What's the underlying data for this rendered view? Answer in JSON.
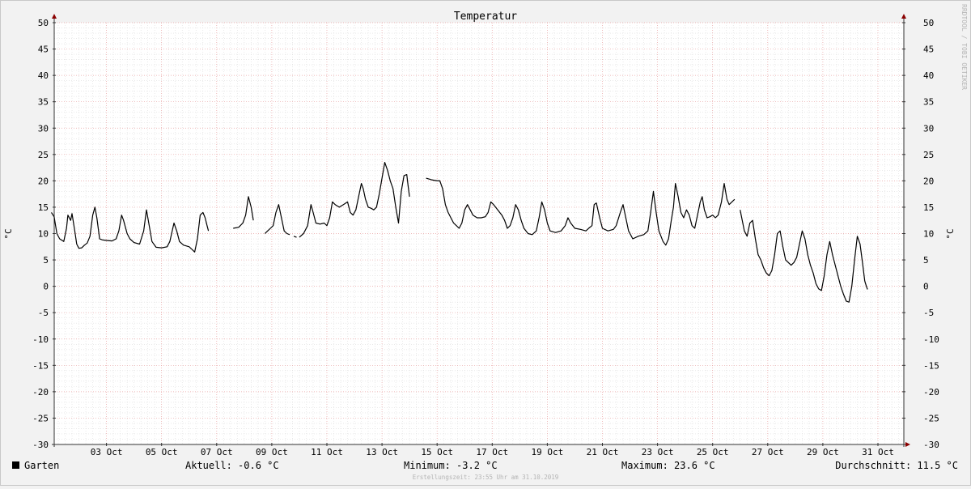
{
  "chart_data": {
    "type": "line",
    "title": "Temperatur",
    "ylabel": "°C",
    "ylim": [
      -30,
      50
    ],
    "yticks": [
      50,
      45,
      40,
      35,
      30,
      25,
      20,
      15,
      10,
      5,
      0,
      -5,
      -10,
      -15,
      -20,
      -25,
      -30
    ],
    "xlim": [
      "2019-10-01 00:00",
      "2019-11-01 00:00"
    ],
    "xtick_labels": [
      {
        "day": 3,
        "label": "03 Oct"
      },
      {
        "day": 5,
        "label": "05 Oct"
      },
      {
        "day": 7,
        "label": "07 Oct"
      },
      {
        "day": 9,
        "label": "09 Oct"
      },
      {
        "day": 11,
        "label": "11 Oct"
      },
      {
        "day": 13,
        "label": "13 Oct"
      },
      {
        "day": 15,
        "label": "15 Oct"
      },
      {
        "day": 17,
        "label": "17 Oct"
      },
      {
        "day": 19,
        "label": "19 Oct"
      },
      {
        "day": 21,
        "label": "21 Oct"
      },
      {
        "day": 23,
        "label": "23 Oct"
      },
      {
        "day": 25,
        "label": "25 Oct"
      },
      {
        "day": 27,
        "label": "27 Oct"
      },
      {
        "day": 29,
        "label": "29 Oct"
      },
      {
        "day": 31,
        "label": "31 Oct"
      }
    ],
    "grid": true,
    "legend": {
      "name": "Garten",
      "color": "#000000",
      "position": "bottom-left"
    },
    "series": [
      {
        "name": "Garten",
        "color": "#000000",
        "segments": [
          [
            [
              1.0,
              14.0
            ],
            [
              1.1,
              13.2
            ],
            [
              1.2,
              10.0
            ],
            [
              1.3,
              9.0
            ],
            [
              1.45,
              8.5
            ],
            [
              1.55,
              11.0
            ],
            [
              1.6,
              13.5
            ],
            [
              1.7,
              12.5
            ],
            [
              1.75,
              13.8
            ],
            [
              1.85,
              10.5
            ],
            [
              1.92,
              8.0
            ],
            [
              2.0,
              7.2
            ],
            [
              2.1,
              7.3
            ],
            [
              2.2,
              7.8
            ],
            [
              2.3,
              8.2
            ],
            [
              2.4,
              9.5
            ],
            [
              2.5,
              13.5
            ],
            [
              2.58,
              15.0
            ],
            [
              2.65,
              13.0
            ],
            [
              2.75,
              9.0
            ],
            [
              2.85,
              8.8
            ],
            [
              3.0,
              8.7
            ],
            [
              3.2,
              8.6
            ],
            [
              3.35,
              9.0
            ],
            [
              3.45,
              10.5
            ],
            [
              3.55,
              13.5
            ],
            [
              3.62,
              12.5
            ],
            [
              3.75,
              10.0
            ],
            [
              3.85,
              9.0
            ],
            [
              4.0,
              8.3
            ],
            [
              4.2,
              8.0
            ],
            [
              4.35,
              10.5
            ],
            [
              4.45,
              14.5
            ],
            [
              4.55,
              11.5
            ],
            [
              4.65,
              8.5
            ],
            [
              4.8,
              7.4
            ],
            [
              5.0,
              7.3
            ],
            [
              5.2,
              7.5
            ],
            [
              5.3,
              8.5
            ],
            [
              5.45,
              12.0
            ],
            [
              5.55,
              10.5
            ],
            [
              5.65,
              8.5
            ],
            [
              5.8,
              7.8
            ],
            [
              6.0,
              7.5
            ],
            [
              6.1,
              7.0
            ],
            [
              6.2,
              6.5
            ],
            [
              6.3,
              9.0
            ],
            [
              6.4,
              13.5
            ],
            [
              6.5,
              14.0
            ],
            [
              6.58,
              13.0
            ],
            [
              6.65,
              11.5
            ],
            [
              6.7,
              10.5
            ]
          ],
          [
            [
              7.6,
              11.0
            ],
            [
              7.8,
              11.2
            ],
            [
              7.95,
              12.0
            ],
            [
              8.05,
              13.5
            ],
            [
              8.15,
              17.0
            ],
            [
              8.25,
              15.0
            ],
            [
              8.33,
              12.5
            ]
          ],
          [
            [
              8.75,
              10.0
            ],
            [
              8.85,
              10.5
            ],
            [
              8.95,
              11.0
            ],
            [
              9.05,
              11.5
            ],
            [
              9.15,
              14.0
            ],
            [
              9.25,
              15.5
            ],
            [
              9.35,
              13.0
            ],
            [
              9.45,
              10.5
            ],
            [
              9.55,
              10.0
            ],
            [
              9.65,
              9.8
            ]
          ],
          [
            [
              9.8,
              9.5
            ],
            [
              9.9,
              9.3
            ]
          ],
          [
            [
              10.0,
              9.3
            ],
            [
              10.15,
              10.0
            ],
            [
              10.3,
              11.5
            ],
            [
              10.42,
              15.5
            ],
            [
              10.5,
              14.0
            ],
            [
              10.6,
              12.0
            ],
            [
              10.75,
              11.8
            ],
            [
              10.9,
              12.0
            ],
            [
              11.0,
              11.5
            ],
            [
              11.1,
              13.0
            ],
            [
              11.2,
              16.0
            ],
            [
              11.3,
              15.5
            ],
            [
              11.45,
              15.0
            ],
            [
              11.6,
              15.5
            ],
            [
              11.75,
              16.0
            ],
            [
              11.85,
              14.0
            ],
            [
              11.95,
              13.5
            ],
            [
              12.05,
              14.5
            ],
            [
              12.15,
              17.0
            ],
            [
              12.25,
              19.5
            ],
            [
              12.32,
              18.5
            ],
            [
              12.4,
              16.5
            ],
            [
              12.5,
              15.0
            ],
            [
              12.6,
              14.8
            ],
            [
              12.7,
              14.5
            ],
            [
              12.8,
              15.0
            ],
            [
              12.9,
              17.5
            ],
            [
              13.0,
              20.5
            ],
            [
              13.1,
              23.5
            ],
            [
              13.2,
              22.0
            ],
            [
              13.3,
              20.0
            ],
            [
              13.4,
              18.5
            ],
            [
              13.5,
              15.0
            ],
            [
              13.6,
              12.0
            ],
            [
              13.7,
              18.0
            ],
            [
              13.8,
              21.0
            ],
            [
              13.9,
              21.2
            ],
            [
              13.95,
              19.0
            ],
            [
              14.0,
              17.0
            ]
          ],
          [
            [
              14.6,
              20.5
            ],
            [
              14.8,
              20.2
            ],
            [
              15.0,
              20.0
            ],
            [
              15.1,
              20.0
            ],
            [
              15.2,
              18.5
            ],
            [
              15.3,
              15.5
            ],
            [
              15.4,
              14.0
            ],
            [
              15.5,
              13.0
            ],
            [
              15.6,
              12.0
            ],
            [
              15.7,
              11.5
            ],
            [
              15.8,
              11.0
            ],
            [
              15.9,
              12.0
            ],
            [
              16.0,
              14.5
            ],
            [
              16.1,
              15.5
            ],
            [
              16.2,
              14.5
            ],
            [
              16.3,
              13.5
            ],
            [
              16.45,
              13.0
            ],
            [
              16.6,
              13.0
            ],
            [
              16.75,
              13.2
            ],
            [
              16.85,
              14.0
            ],
            [
              16.95,
              16.0
            ],
            [
              17.05,
              15.5
            ],
            [
              17.2,
              14.5
            ],
            [
              17.35,
              13.5
            ],
            [
              17.45,
              12.5
            ],
            [
              17.55,
              11.0
            ],
            [
              17.65,
              11.5
            ],
            [
              17.75,
              13.0
            ],
            [
              17.85,
              15.5
            ],
            [
              17.95,
              14.5
            ],
            [
              18.05,
              12.5
            ],
            [
              18.15,
              11.0
            ],
            [
              18.3,
              10.0
            ],
            [
              18.45,
              9.8
            ],
            [
              18.6,
              10.5
            ],
            [
              18.7,
              13.0
            ],
            [
              18.8,
              16.0
            ],
            [
              18.9,
              14.5
            ],
            [
              19.0,
              12.0
            ],
            [
              19.1,
              10.5
            ],
            [
              19.3,
              10.2
            ],
            [
              19.5,
              10.5
            ],
            [
              19.65,
              11.5
            ],
            [
              19.75,
              13.0
            ],
            [
              19.85,
              12.0
            ],
            [
              20.0,
              11.0
            ],
            [
              20.2,
              10.8
            ],
            [
              20.4,
              10.5
            ],
            [
              20.5,
              11.0
            ],
            [
              20.62,
              11.5
            ],
            [
              20.7,
              15.5
            ],
            [
              20.78,
              15.8
            ],
            [
              20.9,
              13.0
            ],
            [
              21.0,
              11.0
            ],
            [
              21.2,
              10.5
            ],
            [
              21.4,
              10.8
            ],
            [
              21.5,
              11.5
            ],
            [
              21.65,
              14.0
            ],
            [
              21.75,
              15.5
            ],
            [
              21.85,
              13.0
            ],
            [
              21.95,
              10.5
            ],
            [
              22.1,
              9.0
            ],
            [
              22.3,
              9.5
            ],
            [
              22.5,
              9.8
            ],
            [
              22.65,
              10.5
            ],
            [
              22.75,
              14.0
            ],
            [
              22.85,
              18.0
            ],
            [
              22.95,
              14.0
            ],
            [
              23.05,
              10.5
            ],
            [
              23.2,
              8.5
            ],
            [
              23.3,
              7.8
            ],
            [
              23.4,
              9.0
            ],
            [
              23.5,
              12.5
            ],
            [
              23.58,
              15.0
            ],
            [
              23.65,
              19.5
            ],
            [
              23.75,
              17.0
            ],
            [
              23.85,
              14.0
            ],
            [
              23.95,
              13.0
            ],
            [
              24.05,
              14.5
            ],
            [
              24.15,
              13.5
            ],
            [
              24.25,
              11.5
            ],
            [
              24.35,
              11.0
            ],
            [
              24.45,
              13.5
            ],
            [
              24.55,
              16.0
            ],
            [
              24.62,
              17.0
            ],
            [
              24.7,
              14.5
            ],
            [
              24.8,
              13.0
            ],
            [
              24.9,
              13.2
            ],
            [
              25.0,
              13.5
            ],
            [
              25.1,
              13.0
            ],
            [
              25.2,
              13.5
            ],
            [
              25.32,
              16.0
            ],
            [
              25.42,
              19.5
            ],
            [
              25.52,
              16.5
            ],
            [
              25.6,
              15.5
            ],
            [
              25.7,
              16.0
            ],
            [
              25.8,
              16.5
            ]
          ],
          [
            [
              26.0,
              14.5
            ],
            [
              26.15,
              10.5
            ],
            [
              26.25,
              9.5
            ],
            [
              26.35,
              12.0
            ],
            [
              26.45,
              12.5
            ],
            [
              26.55,
              9.0
            ],
            [
              26.65,
              6.0
            ],
            [
              26.75,
              5.0
            ],
            [
              26.85,
              3.5
            ],
            [
              26.95,
              2.5
            ],
            [
              27.05,
              2.0
            ],
            [
              27.15,
              3.0
            ],
            [
              27.25,
              6.0
            ],
            [
              27.35,
              10.0
            ],
            [
              27.45,
              10.5
            ],
            [
              27.55,
              7.5
            ],
            [
              27.65,
              5.0
            ],
            [
              27.75,
              4.5
            ],
            [
              27.85,
              4.0
            ],
            [
              27.95,
              4.5
            ],
            [
              28.05,
              5.5
            ],
            [
              28.15,
              8.0
            ],
            [
              28.25,
              10.5
            ],
            [
              28.35,
              9.0
            ],
            [
              28.45,
              6.0
            ],
            [
              28.55,
              4.0
            ],
            [
              28.65,
              2.5
            ],
            [
              28.75,
              0.5
            ],
            [
              28.85,
              -0.5
            ],
            [
              28.95,
              -0.8
            ],
            [
              29.05,
              2.0
            ],
            [
              29.15,
              6.0
            ],
            [
              29.25,
              8.5
            ],
            [
              29.35,
              6.0
            ],
            [
              29.45,
              4.0
            ],
            [
              29.55,
              2.0
            ],
            [
              29.65,
              0.0
            ],
            [
              29.75,
              -1.5
            ],
            [
              29.85,
              -2.8
            ],
            [
              29.95,
              -3.0
            ],
            [
              30.05,
              0.0
            ],
            [
              30.15,
              5.0
            ],
            [
              30.25,
              9.5
            ],
            [
              30.35,
              8.0
            ],
            [
              30.45,
              4.0
            ],
            [
              30.52,
              1.0
            ],
            [
              30.58,
              0.0
            ],
            [
              30.62,
              -0.6
            ]
          ]
        ]
      }
    ]
  },
  "watermark": "RRDTOOL / TOBI OETIKER",
  "legend_bar": {
    "label": "Garten",
    "aktuell": "Aktuell: -0.6 °C",
    "minimum": "Minimum: -3.2 °C",
    "maximum": "Maximum: 23.6 °C",
    "durchschnitt": "Durchschnitt: 11.5 °C"
  },
  "footer": "Erstellungszeit: 23:55 Uhr am 31.10.2019",
  "colors": {
    "background": "#f2f2f2",
    "plot_background": "#ffffff",
    "minor_grid": "#dcdcdc",
    "major_grid": "#e8a0a0",
    "axis": "#333333",
    "arrow": "#8b0000",
    "line": "#000000"
  }
}
